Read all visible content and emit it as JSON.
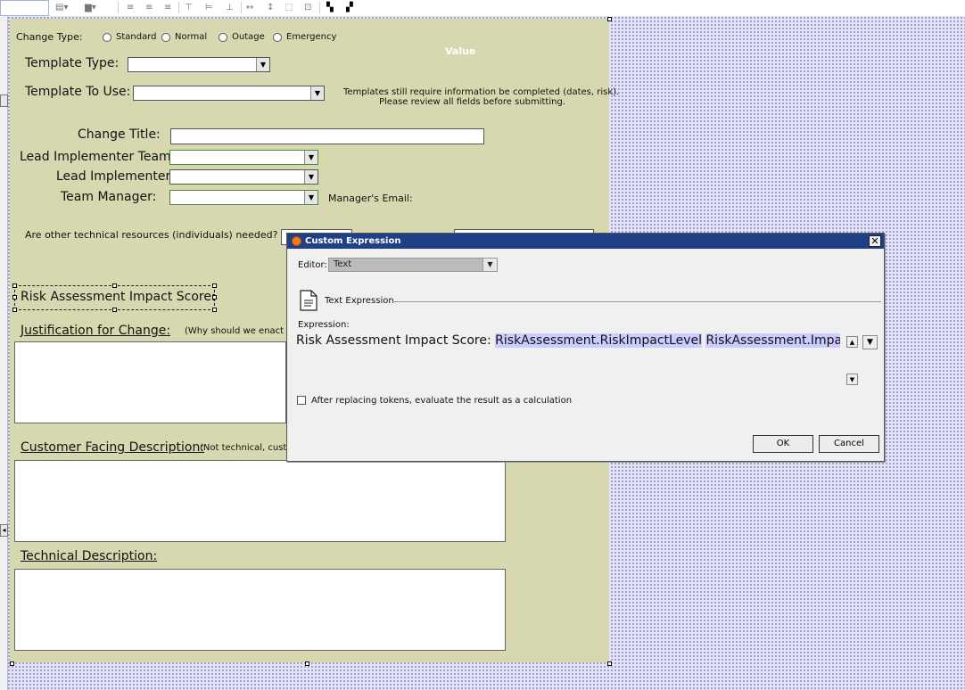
{
  "form": {
    "change_type_label": "Change Type:",
    "change_type_options": [
      "Standard",
      "Normal",
      "Outage",
      "Emergency"
    ],
    "value_header": "Value",
    "template_type_label": "Template Type:",
    "template_to_use_label": "Template To Use:",
    "template_note_line1": "Templates still require information be completed (dates, risk).",
    "template_note_line2": "Please review all fields before submitting.",
    "change_title_label": "Change Title:",
    "lead_team_label": "Lead Implementer Team:",
    "lead_impl_label": "Lead Implementer:",
    "team_manager_label": "Team Manager:",
    "manager_email_label": "Manager's Email:",
    "resources_question": "Are other technical resources (individuals) needed?",
    "risk_label": "Risk Assessment Impact Score:",
    "justification_label": "Justification for Change:",
    "justification_hint": "(Why should we enact t",
    "customer_label": "Customer Facing Description:",
    "customer_hint": "(Not technical, custo",
    "technical_label": "Technical Description:"
  },
  "dialog": {
    "title": "Custom Expression",
    "editor_label": "Editor:",
    "editor_value": "Text",
    "section_label": "Text Expression",
    "expression_label": "Expression:",
    "expression_text": "Risk Assessment Impact Score:",
    "token1": "RiskAssessment.RiskImpactLevel",
    "token2": "RiskAssessment.ImpactTotal",
    "checkbox_label": "After replacing tokens, evaluate the result as a calculation",
    "ok_label": "OK",
    "cancel_label": "Cancel"
  },
  "colors": {
    "form_bg": "#d8d8b0",
    "titlebar": "#1f3f86",
    "token_highlight": "#ccccff"
  }
}
